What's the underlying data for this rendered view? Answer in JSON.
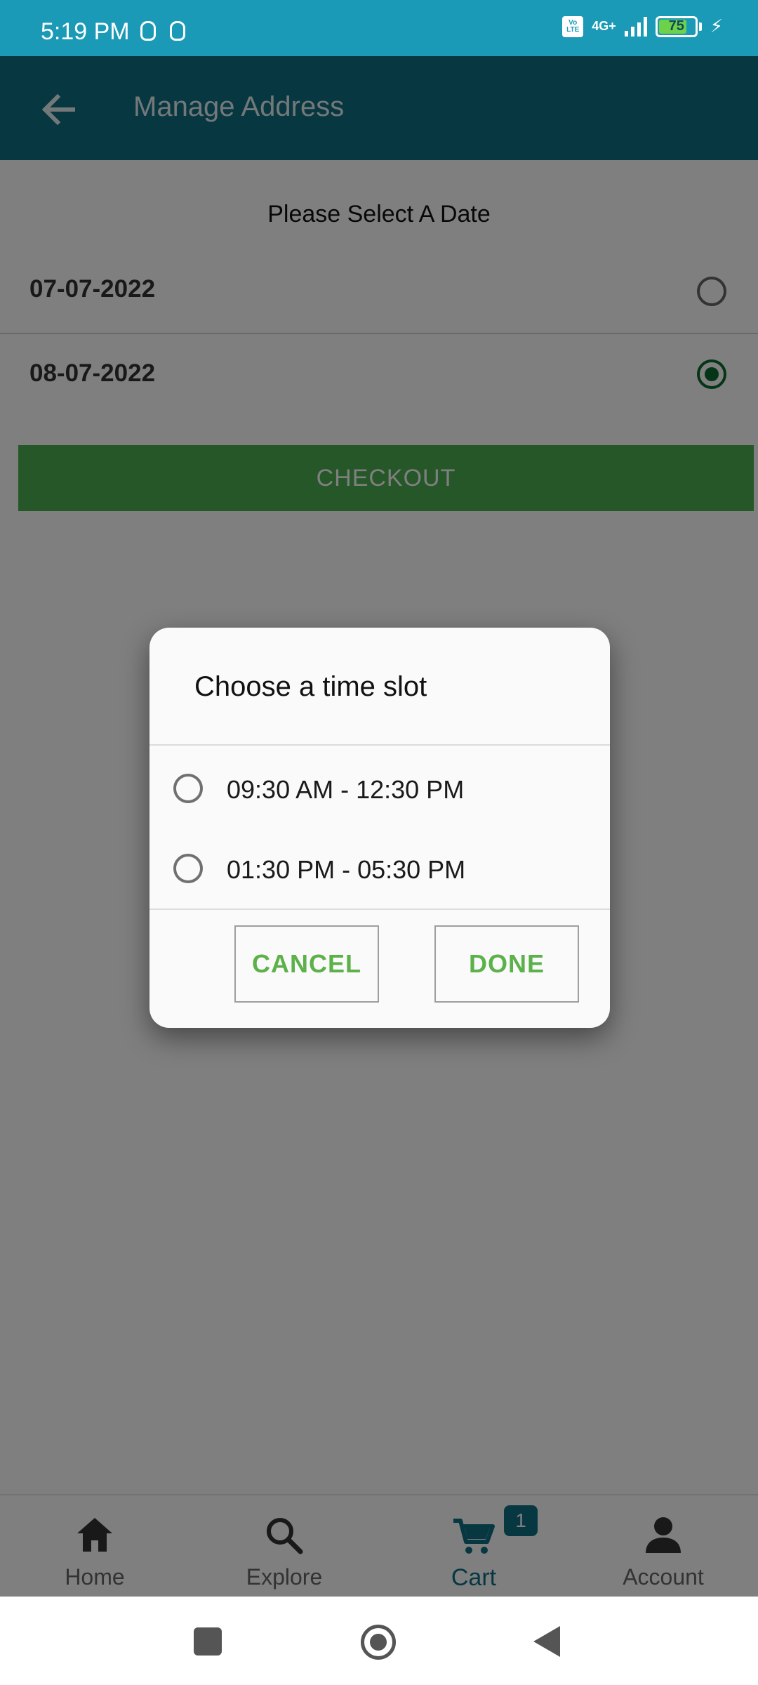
{
  "status_bar": {
    "time": "5:19 PM",
    "volte": "Vo LTE",
    "network": "4G+",
    "battery": "75",
    "battery_level": 0.75
  },
  "app_bar": {
    "title": "Manage Address",
    "back_icon": "arrow-left-icon"
  },
  "main": {
    "section_title": "Please Select A Date",
    "dates": [
      {
        "label": "07-07-2022",
        "selected": false
      },
      {
        "label": "08-07-2022",
        "selected": true
      }
    ],
    "checkout_label": "CHECKOUT"
  },
  "dialog": {
    "title": "Choose a time slot",
    "slots": [
      {
        "label": "09:30 AM - 12:30 PM",
        "selected": false
      },
      {
        "label": "01:30 PM - 05:30 PM",
        "selected": false
      }
    ],
    "cancel_label": "CANCEL",
    "done_label": "DONE"
  },
  "bottom_nav": {
    "items": [
      {
        "label": "Home",
        "icon": "home-icon",
        "active": false
      },
      {
        "label": "Explore",
        "icon": "search-icon",
        "active": false
      },
      {
        "label": "Cart",
        "icon": "cart-icon",
        "active": true,
        "badge": "1"
      },
      {
        "label": "Account",
        "icon": "account-icon",
        "active": false
      }
    ]
  },
  "colors": {
    "status_bar": "#1a9ab6",
    "app_bar": "#0f6e83",
    "checkout": "#4caf50",
    "selected_radio": "#0b6b2f",
    "dialog_button_text": "#5db14a"
  }
}
